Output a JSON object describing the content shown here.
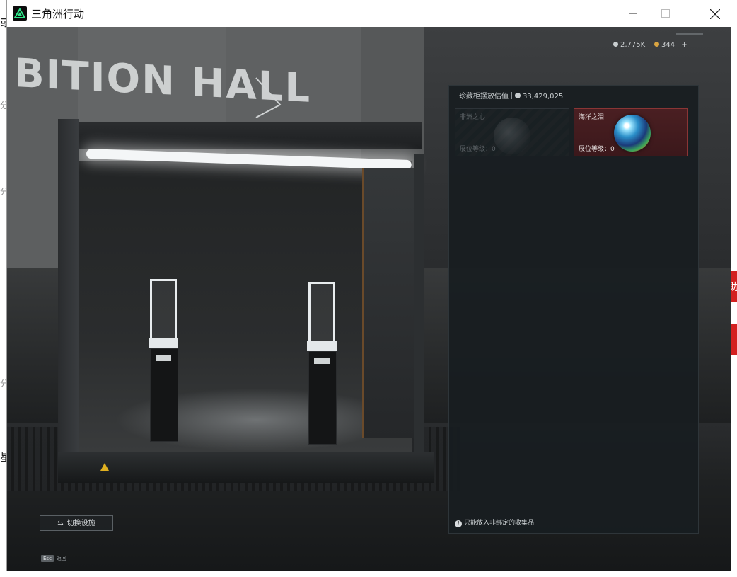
{
  "window": {
    "title": "三角洲行动"
  },
  "scene": {
    "hall_sign": "BITION HALL"
  },
  "currency": {
    "primary": "2,775K",
    "secondary": "344",
    "add_symbol": "+"
  },
  "collection_panel": {
    "header_label": "珍藏柜摆放估值",
    "total_value": "33,429,025",
    "slots": [
      {
        "name": "非洲之心",
        "level_label": "展位等级：0",
        "state": "empty"
      },
      {
        "name": "海洋之泪",
        "level_label": "展位等级：0",
        "state": "filled"
      }
    ],
    "footer_note": "只能放入非绑定的收集品"
  },
  "actions": {
    "switch_facility_label": "切换设施",
    "esc_key": "Esc",
    "esc_label": "返回"
  },
  "behind_window": {
    "edge_glyphs": [
      "或",
      "分",
      "分",
      "分",
      "星"
    ],
    "right_glyph": "助"
  },
  "colors": {
    "panel_bg": "#181d20",
    "selected_slot_border": "#8a3535",
    "accent_red": "#d32020"
  }
}
